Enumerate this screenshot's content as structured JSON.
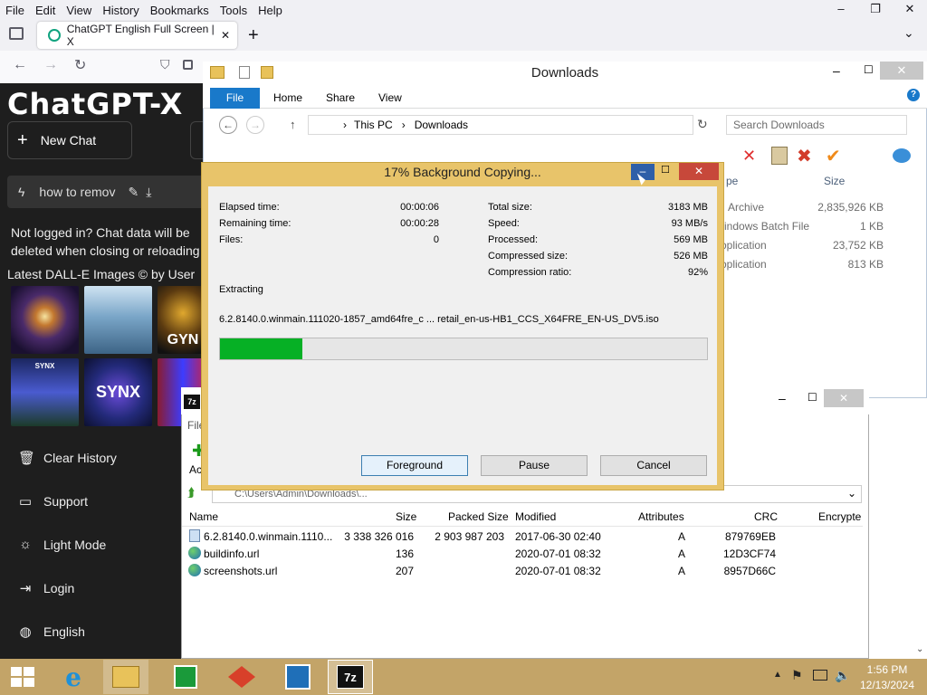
{
  "firefox": {
    "menu": [
      "File",
      "Edit",
      "View",
      "History",
      "Bookmarks",
      "Tools",
      "Help"
    ],
    "tab_title": "ChatGPT English Full Screen | X",
    "win_controls": [
      "–",
      "❐",
      "✕"
    ]
  },
  "chatgpt": {
    "logo": "ChatGPT-X",
    "new_chat": "New Chat",
    "history_item": "how to remov",
    "not_logged": "Not logged in? Chat data will be deleted when closing or reloading",
    "dalle_heading": "Latest DALL-E Images © by User",
    "thumb_texts": [
      "",
      "",
      "GYN",
      "SYNX",
      "SYNX",
      ""
    ],
    "menu": [
      "Clear History",
      "Support",
      "Light Mode",
      "Login",
      "English"
    ]
  },
  "explorer": {
    "title": "Downloads",
    "ribbon_tabs": [
      "File",
      "Home",
      "Share",
      "View"
    ],
    "address": [
      "This PC",
      "Downloads"
    ],
    "search_placeholder": "Search Downloads",
    "col_type": "pe",
    "col_size": "Size",
    "rows": [
      {
        "type": "Archive",
        "size": "2,835,926 KB"
      },
      {
        "type": "indows Batch File",
        "size": "1 KB"
      },
      {
        "type": "oplication",
        "size": "23,752 KB"
      },
      {
        "type": "oplication",
        "size": "813 KB"
      }
    ]
  },
  "zip": {
    "file_menu_fragment": "File",
    "add_fragment": "Ac",
    "path": "C:\\Users\\Admin\\Downloads\\...",
    "columns": [
      "Name",
      "Size",
      "Packed Size",
      "Modified",
      "Attributes",
      "CRC",
      "Encrypte"
    ],
    "rows": [
      {
        "name": "6.2.8140.0.winmain.1110...",
        "size": "3 338 326 016",
        "packed": "2 903 987 203",
        "modified": "2017-06-30 02:40",
        "attr": "A",
        "crc": "879769EB"
      },
      {
        "name": "buildinfo.url",
        "size": "136",
        "packed": "",
        "modified": "2020-07-01 08:32",
        "attr": "A",
        "crc": "12D3CF74"
      },
      {
        "name": "screenshots.url",
        "size": "207",
        "packed": "",
        "modified": "2020-07-01 08:32",
        "attr": "A",
        "crc": "8957D66C"
      }
    ]
  },
  "dialog": {
    "title": "17% Background Copying...",
    "percent": 17,
    "left_stats": [
      {
        "label": "Elapsed time:",
        "value": "00:00:06"
      },
      {
        "label": "Remaining time:",
        "value": "00:00:28"
      },
      {
        "label": "Files:",
        "value": "0"
      }
    ],
    "right_stats": [
      {
        "label": "Total size:",
        "value": "3183 MB"
      },
      {
        "label": "Speed:",
        "value": "93 MB/s"
      },
      {
        "label": "Processed:",
        "value": "569 MB"
      },
      {
        "label": "Compressed size:",
        "value": "526 MB"
      },
      {
        "label": "Compression ratio:",
        "value": "92%"
      }
    ],
    "action": "Extracting",
    "file": "6.2.8140.0.winmain.111020-1857_amd64fre_c ... retail_en-us-HB1_CCS_X64FRE_EN-US_DV5.iso",
    "buttons": {
      "foreground": "Foreground",
      "pause": "Pause",
      "cancel": "Cancel"
    }
  },
  "taskbar": {
    "time": "1:56 PM",
    "date": "12/13/2024",
    "app_7z": "7z"
  },
  "colors": {
    "progress": "#06b025",
    "file_tab": "#1979ca",
    "taskbar": "#c3a468",
    "dialog_frame": "#e8c46a"
  }
}
